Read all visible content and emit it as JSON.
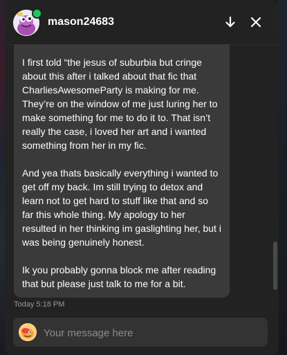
{
  "header": {
    "username": "mason24683",
    "online": true,
    "avatar_icon": "cartoon-character-avatar",
    "actions": {
      "scroll_down_icon": "arrow-down-icon",
      "close_icon": "close-icon"
    }
  },
  "messages": [
    {
      "paragraphs": [
        "I first told “the jesus of suburbia but cringe about this after i talked about that fic that CharliesAwesomeParty is making for me. They’re on the window of me just luring her to make something for me to do it to. That isn’t really the case, i loved her art and i wanted something from her in my fic.",
        "And yea thats basically everything i wanted to get off my back. Im still trying to detox and learn not to get hard to stuff like that and so far this whole thing. My apology to her resulted in her thinking im gaslighting her, but i was being genuinely honest.",
        "Ik you probably gonna block me after reading that but please just talk to me for a bit."
      ],
      "timestamp": "Today 5:18 PM"
    }
  ],
  "composer": {
    "placeholder": "Your message here",
    "value": "",
    "avatar_icon": "own-avatar-icon"
  },
  "colors": {
    "window_bg": "#222222",
    "bubble_bg": "#3a3a3a",
    "online": "#1ec95c",
    "input_bg": "#333333"
  }
}
